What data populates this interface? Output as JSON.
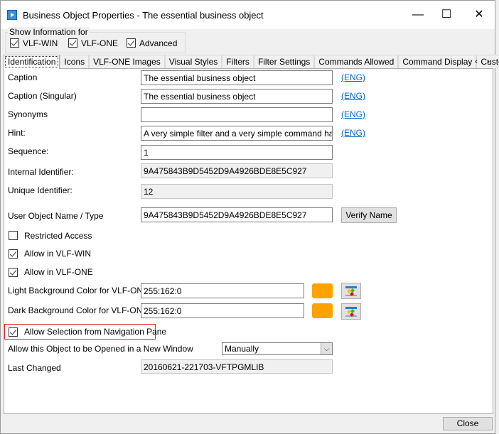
{
  "window": {
    "title": "Business Object Properties - The essential business object",
    "minimize": "—",
    "maximize": "☐",
    "close": "✕"
  },
  "show_info": {
    "label": "Show Information for",
    "options": [
      {
        "label": "VLF-WIN",
        "checked": true
      },
      {
        "label": "VLF-ONE",
        "checked": true
      },
      {
        "label": "Advanced",
        "checked": true
      }
    ]
  },
  "tabs": [
    "Identification",
    "Icons",
    "VLF-ONE Images",
    "Visual Styles",
    "Filters",
    "Filter Settings",
    "Commands Allowed",
    "Command Display",
    "Custom Pr"
  ],
  "tab_scroll": {
    "left": "‹",
    "right": "›"
  },
  "fields": {
    "caption": {
      "label": "Caption",
      "value": "The essential business object",
      "link": "(ENG)"
    },
    "caption_singular": {
      "label": "Caption (Singular)",
      "value": "The essential business object",
      "link": "(ENG)"
    },
    "synonyms": {
      "label": "Synonyms",
      "value": "",
      "link": "(ENG)"
    },
    "hint": {
      "label": "Hint:",
      "value": "A very simple filter and a very simple command handler",
      "link": "(ENG)"
    },
    "sequence": {
      "label": "Sequence:",
      "value": "1"
    },
    "internal_id": {
      "label": "Internal Identifier:",
      "value": "9A475843B9D5452D9A4926BDE8E5C927"
    },
    "unique_id": {
      "label": "Unique Identifier:",
      "value": "12"
    },
    "user_object": {
      "label": "User Object Name / Type",
      "value": "9A475843B9D5452D9A4926BDE8E5C927",
      "button": "Verify Name"
    },
    "restricted": {
      "label": "Restricted Access",
      "checked": false
    },
    "allow_win": {
      "label": "Allow in VLF-WIN",
      "checked": true
    },
    "allow_one": {
      "label": "Allow in VLF-ONE",
      "checked": true
    },
    "light_bg": {
      "label": "Light Background Color for VLF-ONE",
      "value": "255:162:0",
      "color": "#ffa200"
    },
    "dark_bg": {
      "label": "Dark Background Color for VLF-ONE",
      "value": "255:162:0",
      "color": "#ffa200"
    },
    "allow_selection": {
      "label": "Allow Selection from Navigation Pane",
      "checked": true
    },
    "open_new_window": {
      "label": "Allow this Object to be Opened in a New Window",
      "value": "Manually"
    },
    "last_changed": {
      "label": "Last Changed",
      "value": "20160621-221703-VFTPGMLIB"
    }
  },
  "footer": {
    "close": "Close"
  },
  "colors": {
    "highlight": "#e0262a",
    "link": "#0066cc"
  }
}
